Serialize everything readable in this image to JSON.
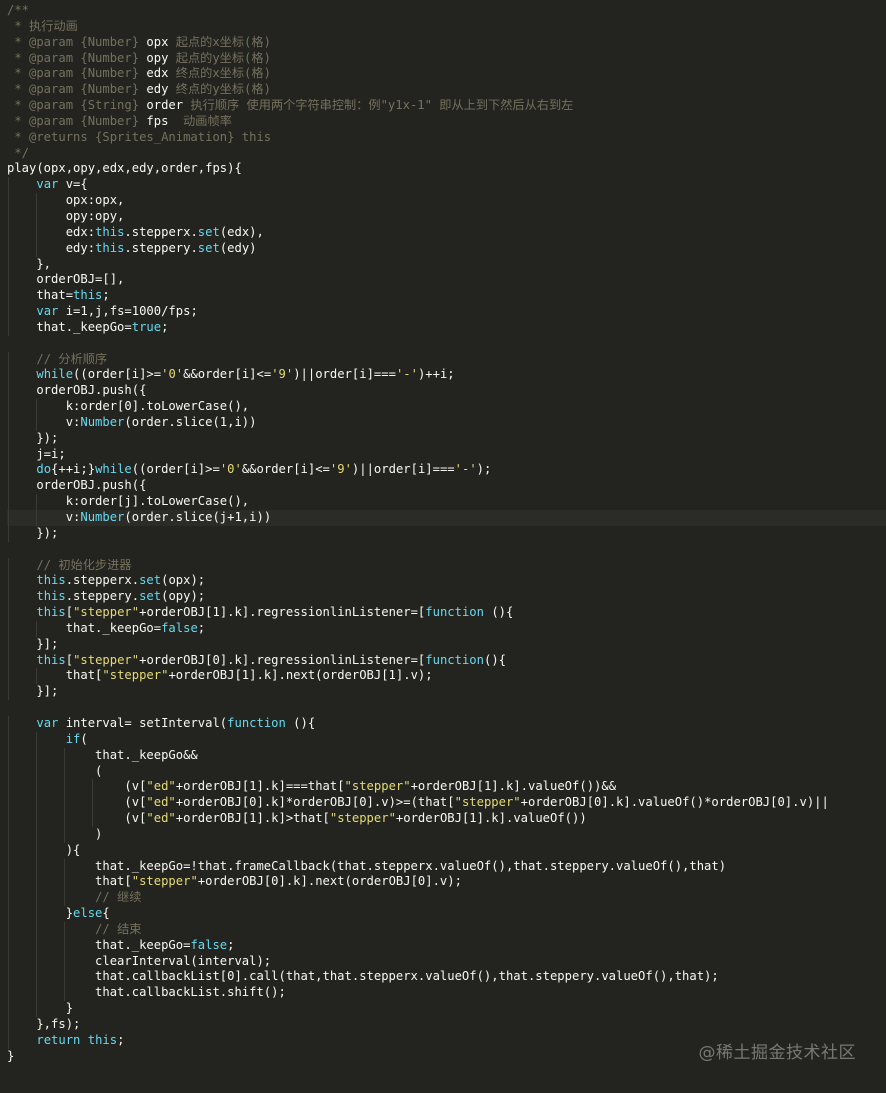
{
  "colors": {
    "background": "#23241f",
    "comment": "#75715e",
    "keyword": "#66d9ef",
    "plain": "#f8f8f2",
    "string": "#e6db74",
    "number": "#ae81ff"
  },
  "watermark": "@稀土掘金技术社区",
  "lines": [
    [
      {
        "t": "/**",
        "c": "comment"
      }
    ],
    [
      {
        "t": " * 执行动画",
        "c": "comment"
      }
    ],
    [
      {
        "t": " * @param {Number} ",
        "c": "comment"
      },
      {
        "t": "opx",
        "c": "plain"
      },
      {
        "t": " 起点的x坐标(格)",
        "c": "comment"
      }
    ],
    [
      {
        "t": " * @param {Number} ",
        "c": "comment"
      },
      {
        "t": "opy",
        "c": "plain"
      },
      {
        "t": " 起点的y坐标(格)",
        "c": "comment"
      }
    ],
    [
      {
        "t": " * @param {Number} ",
        "c": "comment"
      },
      {
        "t": "edx",
        "c": "plain"
      },
      {
        "t": " 终点的x坐标(格)",
        "c": "comment"
      }
    ],
    [
      {
        "t": " * @param {Number} ",
        "c": "comment"
      },
      {
        "t": "edy",
        "c": "plain"
      },
      {
        "t": " 终点的y坐标(格)",
        "c": "comment"
      }
    ],
    [
      {
        "t": " * @param {String} ",
        "c": "comment"
      },
      {
        "t": "order",
        "c": "plain"
      },
      {
        "t": " 执行顺序 使用两个字符串控制：例\"y1x-1\" 即从上到下然后从右到左",
        "c": "comment"
      }
    ],
    [
      {
        "t": " * @param {Number} ",
        "c": "comment"
      },
      {
        "t": "fps",
        "c": "plain"
      },
      {
        "t": "  动画帧率",
        "c": "comment"
      }
    ],
    [
      {
        "t": " * @returns {Sprites_Animation} this",
        "c": "comment"
      }
    ],
    [
      {
        "t": " */",
        "c": "comment"
      }
    ],
    [
      {
        "t": "play(opx,opy,edx,edy,order,fps){",
        "c": "plain"
      }
    ],
    [
      {
        "t": "    ",
        "c": "plain"
      },
      {
        "t": "var",
        "c": "keyword"
      },
      {
        "t": " v={",
        "c": "plain"
      }
    ],
    [
      {
        "t": "        opx:opx,",
        "c": "plain"
      }
    ],
    [
      {
        "t": "        opy:opy,",
        "c": "plain"
      }
    ],
    [
      {
        "t": "        edx:",
        "c": "plain"
      },
      {
        "t": "this",
        "c": "keyword"
      },
      {
        "t": ".stepperx.",
        "c": "plain"
      },
      {
        "t": "set",
        "c": "keyword"
      },
      {
        "t": "(edx),",
        "c": "plain"
      }
    ],
    [
      {
        "t": "        edy:",
        "c": "plain"
      },
      {
        "t": "this",
        "c": "keyword"
      },
      {
        "t": ".steppery.",
        "c": "plain"
      },
      {
        "t": "set",
        "c": "keyword"
      },
      {
        "t": "(edy)",
        "c": "plain"
      }
    ],
    [
      {
        "t": "    },",
        "c": "plain"
      }
    ],
    [
      {
        "t": "    orderOBJ=[],",
        "c": "plain"
      }
    ],
    [
      {
        "t": "    that=",
        "c": "plain"
      },
      {
        "t": "this",
        "c": "keyword"
      },
      {
        "t": ";",
        "c": "plain"
      }
    ],
    [
      {
        "t": "    ",
        "c": "plain"
      },
      {
        "t": "var",
        "c": "keyword"
      },
      {
        "t": " i=1,j,fs=1000/fps;",
        "c": "plain"
      }
    ],
    [
      {
        "t": "    that._keepGo=",
        "c": "plain"
      },
      {
        "t": "true",
        "c": "keyword"
      },
      {
        "t": ";",
        "c": "plain"
      }
    ],
    [
      {
        "t": "",
        "c": "plain"
      }
    ],
    [
      {
        "t": "    ",
        "c": "plain"
      },
      {
        "t": "// 分析顺序",
        "c": "comment"
      }
    ],
    [
      {
        "t": "    ",
        "c": "plain"
      },
      {
        "t": "while",
        "c": "keyword"
      },
      {
        "t": "((order[i]>=",
        "c": "plain"
      },
      {
        "t": "'0'",
        "c": "string"
      },
      {
        "t": "&&order[i]<=",
        "c": "plain"
      },
      {
        "t": "'9'",
        "c": "string"
      },
      {
        "t": ")||order[i]===",
        "c": "plain"
      },
      {
        "t": "'-'",
        "c": "string"
      },
      {
        "t": ")++i;",
        "c": "plain"
      }
    ],
    [
      {
        "t": "    orderOBJ.push({",
        "c": "plain"
      }
    ],
    [
      {
        "t": "        k:order[0].toLowerCase(),",
        "c": "plain"
      }
    ],
    [
      {
        "t": "        v:",
        "c": "plain"
      },
      {
        "t": "Number",
        "c": "keyword"
      },
      {
        "t": "(order.slice(1,i))",
        "c": "plain"
      }
    ],
    [
      {
        "t": "    });",
        "c": "plain"
      }
    ],
    [
      {
        "t": "    j=i;",
        "c": "plain"
      }
    ],
    [
      {
        "t": "    ",
        "c": "plain"
      },
      {
        "t": "do",
        "c": "keyword"
      },
      {
        "t": "{++i;}",
        "c": "plain"
      },
      {
        "t": "while",
        "c": "keyword"
      },
      {
        "t": "((order[i]>=",
        "c": "plain"
      },
      {
        "t": "'0'",
        "c": "string"
      },
      {
        "t": "&&order[i]<=",
        "c": "plain"
      },
      {
        "t": "'9'",
        "c": "string"
      },
      {
        "t": ")||order[i]===",
        "c": "plain"
      },
      {
        "t": "'-'",
        "c": "string"
      },
      {
        "t": ");",
        "c": "plain"
      }
    ],
    [
      {
        "t": "    orderOBJ.push({",
        "c": "plain"
      }
    ],
    [
      {
        "t": "        k:order[j].toLowerCase(),",
        "c": "plain"
      }
    ],
    [
      {
        "t": "        v:",
        "c": "plain"
      },
      {
        "t": "Number",
        "c": "keyword"
      },
      {
        "t": "(order.slice(j+1,i))",
        "c": "plain"
      }
    ],
    [
      {
        "t": "    });",
        "c": "plain"
      }
    ],
    [
      {
        "t": "",
        "c": "plain"
      }
    ],
    [
      {
        "t": "    ",
        "c": "plain"
      },
      {
        "t": "// 初始化步进器",
        "c": "comment"
      }
    ],
    [
      {
        "t": "    ",
        "c": "plain"
      },
      {
        "t": "this",
        "c": "keyword"
      },
      {
        "t": ".stepperx.",
        "c": "plain"
      },
      {
        "t": "set",
        "c": "keyword"
      },
      {
        "t": "(opx);",
        "c": "plain"
      }
    ],
    [
      {
        "t": "    ",
        "c": "plain"
      },
      {
        "t": "this",
        "c": "keyword"
      },
      {
        "t": ".steppery.",
        "c": "plain"
      },
      {
        "t": "set",
        "c": "keyword"
      },
      {
        "t": "(opy);",
        "c": "plain"
      }
    ],
    [
      {
        "t": "    ",
        "c": "plain"
      },
      {
        "t": "this",
        "c": "keyword"
      },
      {
        "t": "[",
        "c": "plain"
      },
      {
        "t": "\"stepper\"",
        "c": "string"
      },
      {
        "t": "+orderOBJ[1].k].regressionlinListener=[",
        "c": "plain"
      },
      {
        "t": "function",
        "c": "keyword"
      },
      {
        "t": " (){",
        "c": "plain"
      }
    ],
    [
      {
        "t": "        that._keepGo=",
        "c": "plain"
      },
      {
        "t": "false",
        "c": "keyword"
      },
      {
        "t": ";",
        "c": "plain"
      }
    ],
    [
      {
        "t": "    }];",
        "c": "plain"
      }
    ],
    [
      {
        "t": "    ",
        "c": "plain"
      },
      {
        "t": "this",
        "c": "keyword"
      },
      {
        "t": "[",
        "c": "plain"
      },
      {
        "t": "\"stepper\"",
        "c": "string"
      },
      {
        "t": "+orderOBJ[0].k].regressionlinListener=[",
        "c": "plain"
      },
      {
        "t": "function",
        "c": "keyword"
      },
      {
        "t": "(){",
        "c": "plain"
      }
    ],
    [
      {
        "t": "        that[",
        "c": "plain"
      },
      {
        "t": "\"stepper\"",
        "c": "string"
      },
      {
        "t": "+orderOBJ[1].k].next(orderOBJ[1].v);",
        "c": "plain"
      }
    ],
    [
      {
        "t": "    }];",
        "c": "plain"
      }
    ],
    [
      {
        "t": "",
        "c": "plain"
      }
    ],
    [
      {
        "t": "    ",
        "c": "plain"
      },
      {
        "t": "var",
        "c": "keyword"
      },
      {
        "t": " interval= setInterval(",
        "c": "plain"
      },
      {
        "t": "function",
        "c": "keyword"
      },
      {
        "t": " (){",
        "c": "plain"
      }
    ],
    [
      {
        "t": "        ",
        "c": "plain"
      },
      {
        "t": "if",
        "c": "keyword"
      },
      {
        "t": "(",
        "c": "plain"
      }
    ],
    [
      {
        "t": "            that._keepGo&&",
        "c": "plain"
      }
    ],
    [
      {
        "t": "            (",
        "c": "plain"
      }
    ],
    [
      {
        "t": "                (v[",
        "c": "plain"
      },
      {
        "t": "\"ed\"",
        "c": "string"
      },
      {
        "t": "+orderOBJ[1].k]===that[",
        "c": "plain"
      },
      {
        "t": "\"stepper\"",
        "c": "string"
      },
      {
        "t": "+orderOBJ[1].k].valueOf())&&",
        "c": "plain"
      }
    ],
    [
      {
        "t": "                (v[",
        "c": "plain"
      },
      {
        "t": "\"ed\"",
        "c": "string"
      },
      {
        "t": "+orderOBJ[0].k]*orderOBJ[0].v)>=(that[",
        "c": "plain"
      },
      {
        "t": "\"stepper\"",
        "c": "string"
      },
      {
        "t": "+orderOBJ[0].k].valueOf()*orderOBJ[0].v)||",
        "c": "plain"
      }
    ],
    [
      {
        "t": "                (v[",
        "c": "plain"
      },
      {
        "t": "\"ed\"",
        "c": "string"
      },
      {
        "t": "+orderOBJ[1].k]>that[",
        "c": "plain"
      },
      {
        "t": "\"stepper\"",
        "c": "string"
      },
      {
        "t": "+orderOBJ[1].k].valueOf())",
        "c": "plain"
      }
    ],
    [
      {
        "t": "            )",
        "c": "plain"
      }
    ],
    [
      {
        "t": "        ){",
        "c": "plain"
      }
    ],
    [
      {
        "t": "            that._keepGo=!that.frameCallback(that.stepperx.valueOf(),that.steppery.valueOf(),that)",
        "c": "plain"
      }
    ],
    [
      {
        "t": "            that[",
        "c": "plain"
      },
      {
        "t": "\"stepper\"",
        "c": "string"
      },
      {
        "t": "+orderOBJ[0].k].next(orderOBJ[0].v);",
        "c": "plain"
      }
    ],
    [
      {
        "t": "            ",
        "c": "plain"
      },
      {
        "t": "// 继续",
        "c": "comment"
      }
    ],
    [
      {
        "t": "        }",
        "c": "plain"
      },
      {
        "t": "else",
        "c": "keyword"
      },
      {
        "t": "{",
        "c": "plain"
      }
    ],
    [
      {
        "t": "            ",
        "c": "plain"
      },
      {
        "t": "// 结束",
        "c": "comment"
      }
    ],
    [
      {
        "t": "            that._keepGo=",
        "c": "plain"
      },
      {
        "t": "false",
        "c": "keyword"
      },
      {
        "t": ";",
        "c": "plain"
      }
    ],
    [
      {
        "t": "            clearInterval(interval);",
        "c": "plain"
      }
    ],
    [
      {
        "t": "            that.callbackList[0].call(that,that.stepperx.valueOf(),that.steppery.valueOf(),that);",
        "c": "plain"
      }
    ],
    [
      {
        "t": "            that.callbackList.shift();",
        "c": "plain"
      }
    ],
    [
      {
        "t": "        }",
        "c": "plain"
      }
    ],
    [
      {
        "t": "    },fs);",
        "c": "plain"
      }
    ],
    [
      {
        "t": "    ",
        "c": "plain"
      },
      {
        "t": "return",
        "c": "keyword"
      },
      {
        "t": " ",
        "c": "plain"
      },
      {
        "t": "this",
        "c": "keyword"
      },
      {
        "t": ";",
        "c": "plain"
      }
    ],
    [
      {
        "t": "}",
        "c": "plain"
      }
    ]
  ]
}
